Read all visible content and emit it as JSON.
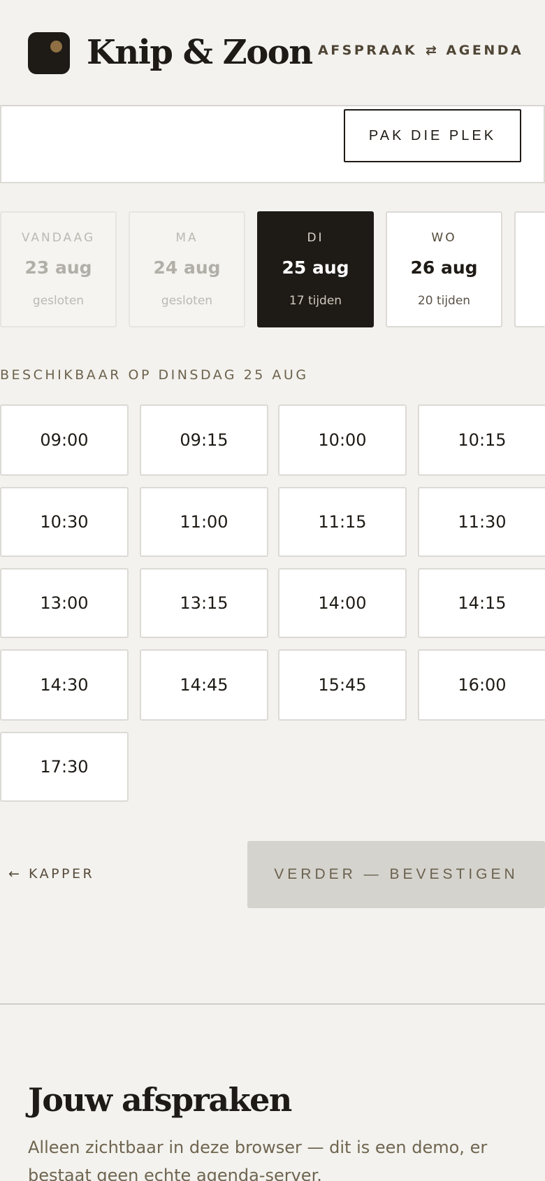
{
  "header": {
    "brand": "Knip & Zoon",
    "nav": {
      "afspraak": "AFSPRAAK",
      "agenda": "⇄ AGENDA"
    }
  },
  "top_card": {
    "claim_button": "PAK DIE PLEK"
  },
  "days": [
    {
      "dow": "VANDAAG",
      "date": "23 aug",
      "count": "gesloten",
      "state": "closed"
    },
    {
      "dow": "MA",
      "date": "24 aug",
      "count": "gesloten",
      "state": "closed"
    },
    {
      "dow": "DI",
      "date": "25 aug",
      "count": "17 tijden",
      "state": "selected"
    },
    {
      "dow": "WO",
      "date": "26 aug",
      "count": "20 tijden",
      "state": "open"
    }
  ],
  "available_label": "BESCHIKBAAR OP DINSDAG 25 AUG",
  "slots": [
    "09:00",
    "09:15",
    "10:00",
    "10:15",
    "10:30",
    "11:00",
    "11:15",
    "11:30",
    "13:00",
    "13:15",
    "14:00",
    "14:15",
    "14:30",
    "14:45",
    "15:45",
    "16:00",
    "17:30"
  ],
  "actions": {
    "back": "← KAPPER",
    "continue": "VERDER — BEVESTIGEN"
  },
  "appointments": {
    "title": "Jouw afspraken",
    "text": "Alleen zichtbaar in deze browser — dit is een demo, er bestaat geen echte agenda-server."
  },
  "colors": {
    "background": "#f3f2ee",
    "ink": "#1e1a15",
    "accent": "#8f6f43",
    "disabled_button": "#d5d3cd"
  }
}
